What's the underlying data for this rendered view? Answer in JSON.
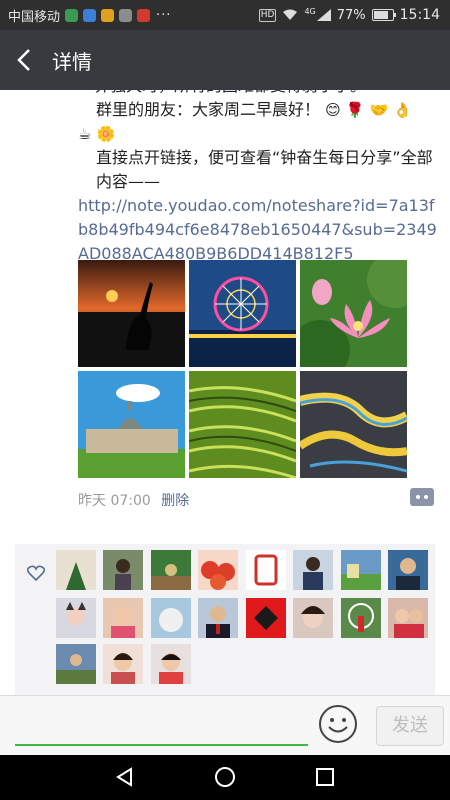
{
  "status_bar": {
    "carrier": "中国移动",
    "network": "4G",
    "battery": "77%",
    "time": "15:14",
    "hd": "HD"
  },
  "header": {
    "title": "详情"
  },
  "post": {
    "line_top": "一界强大时，所有的困难都变得弱小了。",
    "greeting": "群里的朋友：大家周二早晨好！",
    "link_intro": "直接点开链接，便可查看“钟奋生每日分享”全部内容——",
    "url": "http://note.youdao.com/noteshare?id=7a13fb8b49fb494cf6e8478eb1650447&sub=2349AD088ACA480B9B6DD414B812F5"
  },
  "photos": [
    {
      "name": "sunset-heron-photo"
    },
    {
      "name": "ferris-wheel-photo"
    },
    {
      "name": "lotus-flower-photo"
    },
    {
      "name": "palace-photo"
    },
    {
      "name": "rice-terraces-photo"
    },
    {
      "name": "river-delta-photo"
    }
  ],
  "meta": {
    "time": "昨天 07:00",
    "delete_label": "删除"
  },
  "likes": {
    "count": 19
  },
  "input_bar": {
    "send_label": "发送"
  },
  "colors": {
    "title_bar": "#393a3f",
    "link": "#576b95",
    "accent_green": "#3dbb3a",
    "likes_bg": "#f3f3f5"
  }
}
